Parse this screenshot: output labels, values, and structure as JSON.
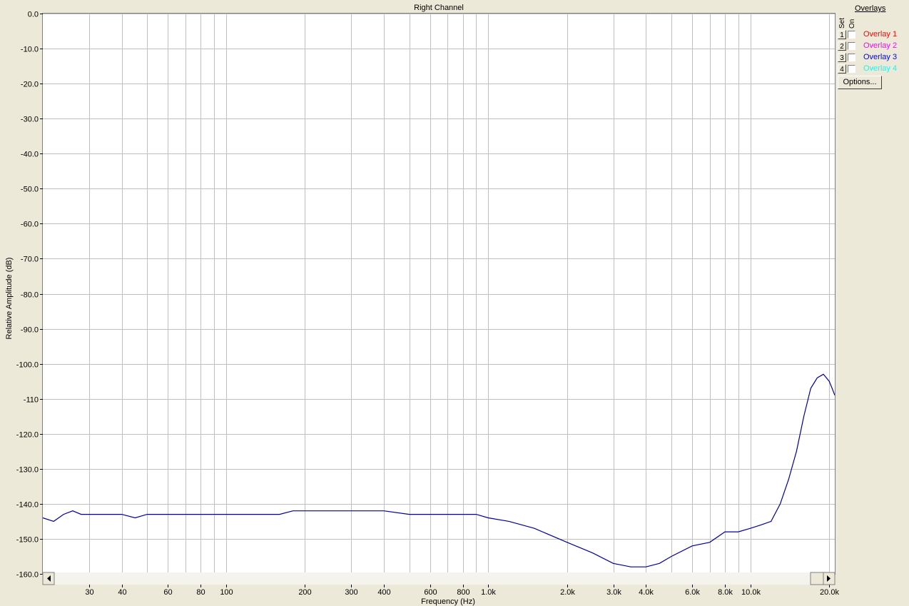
{
  "chart_data": {
    "type": "line",
    "title": "Right Channel",
    "xlabel": "Frequency (Hz)",
    "ylabel": "Relative Amplitude (dB)",
    "x_scale": "log",
    "xlim": [
      20,
      21000
    ],
    "ylim": [
      -160,
      0
    ],
    "grid": true,
    "x_ticks": [
      {
        "value": 30,
        "label": "30"
      },
      {
        "value": 40,
        "label": "40"
      },
      {
        "value": 60,
        "label": "60"
      },
      {
        "value": 80,
        "label": "80"
      },
      {
        "value": 100,
        "label": "100"
      },
      {
        "value": 200,
        "label": "200"
      },
      {
        "value": 300,
        "label": "300"
      },
      {
        "value": 400,
        "label": "400"
      },
      {
        "value": 600,
        "label": "600"
      },
      {
        "value": 800,
        "label": "800"
      },
      {
        "value": 1000,
        "label": "1.0k"
      },
      {
        "value": 2000,
        "label": "2.0k"
      },
      {
        "value": 3000,
        "label": "3.0k"
      },
      {
        "value": 4000,
        "label": "4.0k"
      },
      {
        "value": 6000,
        "label": "6.0k"
      },
      {
        "value": 8000,
        "label": "8.0k"
      },
      {
        "value": 10000,
        "label": "10.0k"
      },
      {
        "value": 20000,
        "label": "20.0k"
      }
    ],
    "x_minor_grid": [
      50,
      70,
      90,
      500,
      700,
      900,
      5000,
      7000,
      9000
    ],
    "y_ticks": [
      {
        "value": 0,
        "label": "0.0"
      },
      {
        "value": -10,
        "label": "-10.0"
      },
      {
        "value": -20,
        "label": "-20.0"
      },
      {
        "value": -30,
        "label": "-30.0"
      },
      {
        "value": -40,
        "label": "-40.0"
      },
      {
        "value": -50,
        "label": "-50.0"
      },
      {
        "value": -60,
        "label": "-60.0"
      },
      {
        "value": -70,
        "label": "-70.0"
      },
      {
        "value": -80,
        "label": "-80.0"
      },
      {
        "value": -90,
        "label": "-90.0"
      },
      {
        "value": -100,
        "label": "-100.0"
      },
      {
        "value": -110,
        "label": "-110"
      },
      {
        "value": -120,
        "label": "-120.0"
      },
      {
        "value": -130,
        "label": "-130.0"
      },
      {
        "value": -140,
        "label": "-140.0"
      },
      {
        "value": -150,
        "label": "-150.0"
      },
      {
        "value": -160,
        "label": "-160.0"
      }
    ],
    "series": [
      {
        "color": "#0000a0",
        "x": [
          20,
          22,
          24,
          26,
          28,
          30,
          33,
          36,
          40,
          45,
          50,
          55,
          60,
          70,
          80,
          90,
          100,
          130,
          160,
          180,
          200,
          250,
          300,
          350,
          400,
          500,
          600,
          700,
          800,
          900,
          1000,
          1200,
          1500,
          2000,
          2500,
          3000,
          3500,
          4000,
          4500,
          5000,
          6000,
          7000,
          8000,
          9000,
          10000,
          11000,
          12000,
          13000,
          14000,
          15000,
          16000,
          17000,
          18000,
          19000,
          20000,
          20500,
          21000
        ],
        "y": [
          -144,
          -145,
          -143,
          -142,
          -143,
          -143,
          -143,
          -143,
          -143,
          -144,
          -143,
          -143,
          -143,
          -143,
          -143,
          -143,
          -143,
          -143,
          -143,
          -142,
          -142,
          -142,
          -142,
          -142,
          -142,
          -143,
          -143,
          -143,
          -143,
          -143,
          -144,
          -145,
          -147,
          -151,
          -154,
          -157,
          -158,
          -158,
          -157,
          -155,
          -152,
          -151,
          -148,
          -148,
          -147,
          -146,
          -145,
          -140,
          -133,
          -125,
          -115,
          -107,
          -104,
          -103,
          -105,
          -107,
          -109
        ]
      }
    ]
  },
  "overlays_panel": {
    "heading": "Overlays",
    "set_label": "Set",
    "on_label": "On",
    "items": [
      {
        "number": "1",
        "label": "Overlay 1",
        "color": "#ff0000",
        "checked": false
      },
      {
        "number": "2",
        "label": "Overlay 2",
        "color": "#ff00ff",
        "checked": false
      },
      {
        "number": "3",
        "label": "Overlay 3",
        "color": "#0000ff",
        "checked": false
      },
      {
        "number": "4",
        "label": "Overlay 4",
        "color": "#00ffff",
        "checked": false
      }
    ],
    "options_label": "Options..."
  }
}
